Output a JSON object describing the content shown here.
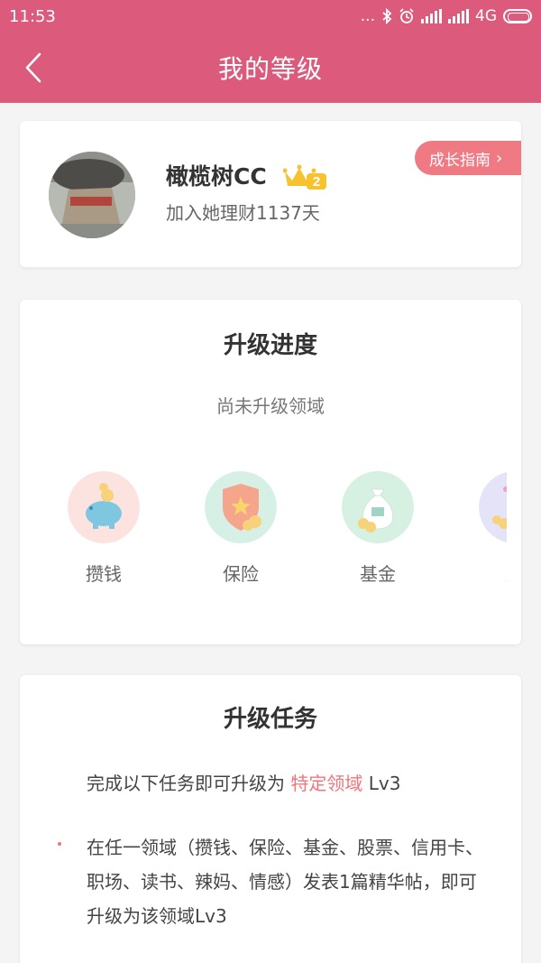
{
  "status_bar": {
    "time": "11:53",
    "dots": "...",
    "network": "4G"
  },
  "header": {
    "title": "我的等级"
  },
  "profile": {
    "name": "橄榄树CC",
    "level_badge": "2",
    "join_text": "加入她理财1137天",
    "guide_button": "成长指南",
    "guide_chevron": "›"
  },
  "progress": {
    "title": "升级进度",
    "subtitle": "尚未升级领域",
    "domains": [
      {
        "label": "攒钱",
        "icon": "piggy-bank-icon",
        "bg": "#fde3df"
      },
      {
        "label": "保险",
        "icon": "shield-star-icon",
        "bg": "#d7f0e6"
      },
      {
        "label": "基金",
        "icon": "money-bag-icon",
        "bg": "#d6f0e2"
      },
      {
        "label": "股",
        "icon": "stock-icon",
        "bg": "#e5e3f7"
      }
    ]
  },
  "tasks": {
    "title": "升级任务",
    "intro_prefix": "完成以下任务即可升级为 ",
    "intro_highlight": "特定领域",
    "intro_suffix": " Lv3",
    "bullet": "在任一领域（攒钱、保险、基金、股票、信用卡、职场、读书、辣妈、情感）发表1篇精华帖，即可升级为该领域Lv3"
  },
  "colors": {
    "primary": "#dc5a7c",
    "accent": "#f07a84",
    "highlight": "#f0747c"
  }
}
